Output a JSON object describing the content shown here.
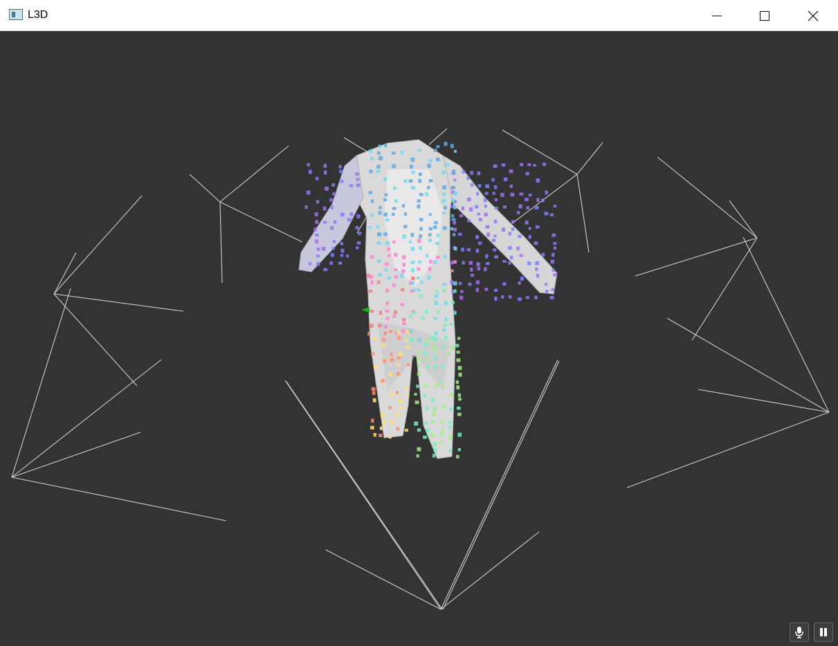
{
  "window": {
    "title": "L3D",
    "app_icon": "app-window-icon",
    "controls": [
      "minimize-icon",
      "maximize-icon",
      "close-icon"
    ]
  },
  "viewport": {
    "background": "#333333",
    "body_color": "#d9d9d9",
    "camera_line_color": "#d0d0d0",
    "marker_color": "#00c000",
    "point_palette": [
      "#8080ff",
      "#a070f0",
      "#70d8f0",
      "#60a8e0",
      "#ff80d0",
      "#f08080",
      "#ffe070",
      "#a0f080",
      "#70f0c0",
      "#ff9070"
    ]
  },
  "overlay_buttons": [
    {
      "name": "microphone-icon"
    },
    {
      "name": "pause-icon"
    }
  ]
}
